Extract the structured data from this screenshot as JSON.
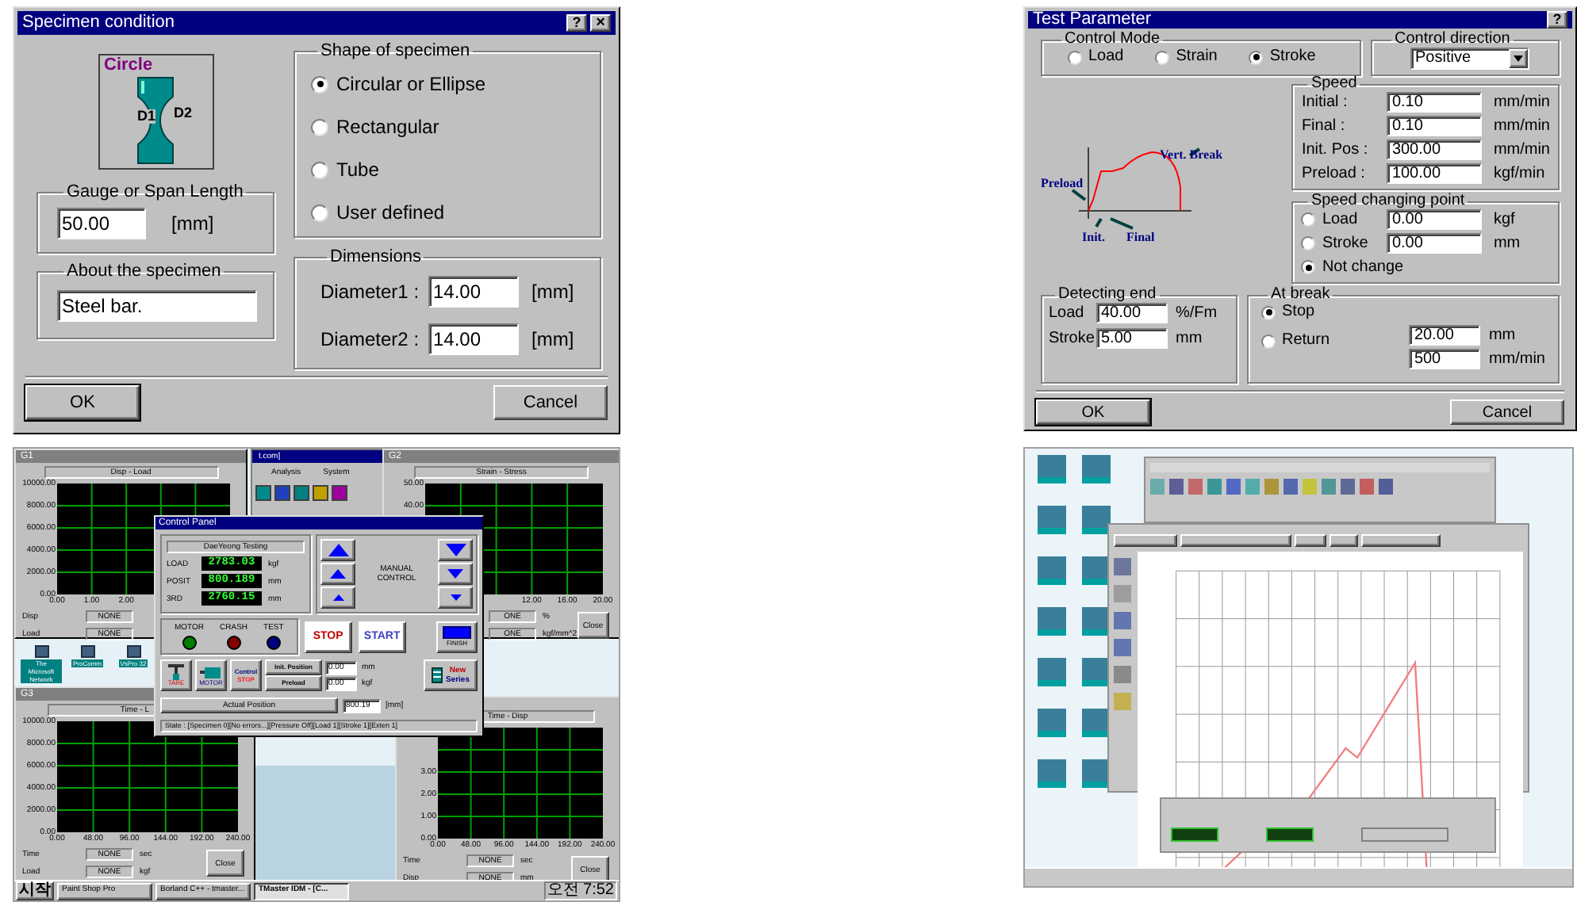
{
  "specimen_dialog": {
    "title": "Specimen condition",
    "help": "?",
    "close": "×",
    "picture": {
      "caption": "Circle",
      "d1": "D1",
      "d2": "D2"
    },
    "gauge": {
      "title": "Gauge or Span Length",
      "value": "50.00",
      "unit": "[mm]"
    },
    "about": {
      "title": "About the specimen",
      "value": "Steel bar."
    },
    "shape": {
      "title": "Shape of specimen",
      "options": [
        {
          "label": "Circular or Ellipse",
          "selected": true
        },
        {
          "label": "Rectangular",
          "selected": false
        },
        {
          "label": "Tube",
          "selected": false
        },
        {
          "label": "User defined",
          "selected": false
        }
      ]
    },
    "dimensions": {
      "title": "Dimensions",
      "rows": [
        {
          "label": "Diameter1 :",
          "value": "14.00",
          "unit": "[mm]"
        },
        {
          "label": "Diameter2 :",
          "value": "14.00",
          "unit": "[mm]"
        }
      ]
    },
    "buttons": [
      "OK",
      "Cancel"
    ]
  },
  "test_dialog": {
    "title": "Test Parameter",
    "help": "?",
    "control_mode": {
      "title": "Control Mode",
      "options": [
        {
          "label": "Load",
          "selected": false
        },
        {
          "label": "Strain",
          "selected": false
        },
        {
          "label": "Stroke",
          "selected": true
        }
      ]
    },
    "control_direction": {
      "title": "Control direction",
      "value": "Positive"
    },
    "diagram": {
      "vert_break": "Vert. Break",
      "preload": "Preload",
      "init": "Init.",
      "final": "Final"
    },
    "speed": {
      "title": "Speed",
      "rows": [
        {
          "label": "Initial :",
          "value": "0.10",
          "unit": "mm/min"
        },
        {
          "label": "Final :",
          "value": "0.10",
          "unit": "mm/min"
        },
        {
          "label": "Init. Pos :",
          "value": "300.00",
          "unit": "mm/min"
        },
        {
          "label": "Preload :",
          "value": "100.00",
          "unit": "kgf/min"
        }
      ]
    },
    "speed_changing_point": {
      "title": "Speed changing point",
      "options": [
        {
          "label": "Load",
          "value": "0.00",
          "unit": "kgf",
          "selected": false
        },
        {
          "label": "Stroke",
          "value": "0.00",
          "unit": "mm",
          "selected": false
        },
        {
          "label": "Not change",
          "selected": true
        }
      ]
    },
    "detecting_end": {
      "title": "Detecting end",
      "rows": [
        {
          "label": "Load",
          "value": "40.00",
          "unit": "%/Fm"
        },
        {
          "label": "Stroke",
          "value": "5.00",
          "unit": "mm"
        }
      ]
    },
    "at_break": {
      "title": "At break",
      "options": [
        {
          "label": "Stop",
          "selected": true
        },
        {
          "label": "Return",
          "selected": false
        }
      ],
      "fields": [
        {
          "value": "20.00",
          "unit": "mm"
        },
        {
          "value": "500",
          "unit": "mm/min"
        }
      ]
    },
    "buttons": [
      "OK",
      "Cancel"
    ]
  },
  "desktop": {
    "app_window": {
      "title": "t.com]",
      "menu": [
        "Analysis",
        "System"
      ]
    },
    "icons": [
      "The Microsoft Network",
      "ProComm",
      "VsPro 32"
    ],
    "graphs": [
      {
        "title": "G1",
        "caption": "Disp - Load",
        "y_ticks": [
          "10000.00",
          "8000.00",
          "6000.00",
          "4000.00",
          "2000.00",
          "0.00"
        ],
        "x_ticks": [
          "0.00",
          "1.00",
          "2.00"
        ],
        "readouts": [
          {
            "label": "Disp",
            "value": "NONE"
          },
          {
            "label": "Load",
            "value": "NONE"
          }
        ]
      },
      {
        "title": "G2",
        "caption": "Strain - Stress",
        "y_ticks": [
          "50.00",
          "40.00"
        ],
        "x_ticks": [
          "12.00",
          "16.00",
          "20.00"
        ],
        "readouts": [
          {
            "value": "ONE",
            "unit": "%"
          },
          {
            "value": "ONE",
            "unit": "kgf/mm^2"
          }
        ],
        "close": "Close"
      },
      {
        "title": "G3",
        "caption": "Time - L",
        "y_ticks": [
          "10000.00",
          "8000.00",
          "6000.00",
          "4000.00",
          "2000.00",
          "0.00"
        ],
        "x_ticks": [
          "0.00",
          "48.00",
          "96.00",
          "144.00",
          "192.00",
          "240.00"
        ],
        "readouts": [
          {
            "label": "Time",
            "value": "NONE",
            "unit": "sec"
          },
          {
            "label": "Load",
            "value": "NONE",
            "unit": "kgf"
          }
        ],
        "close": "Close"
      },
      {
        "caption": "Time - Disp",
        "y_ticks": [
          "3.00",
          "2.00",
          "1.00",
          "0.00"
        ],
        "x_ticks": [
          "0.00",
          "48.00",
          "96.00",
          "144.00",
          "192.00",
          "240.00"
        ],
        "readouts": [
          {
            "label": "Time",
            "value": "NONE",
            "unit": "sec"
          },
          {
            "label": "Disp",
            "value": "NONE",
            "unit": "mm"
          }
        ],
        "close": "Close"
      }
    ],
    "control_panel": {
      "title": "Control Panel",
      "caption": "DaeYeong Testing",
      "readouts": [
        {
          "label": "LOAD",
          "value": "2783.03",
          "unit": "kgf"
        },
        {
          "label": "POSIT",
          "value": "800.189",
          "unit": "mm"
        },
        {
          "label": "3RD",
          "value": "2760.15",
          "unit": "mm"
        }
      ],
      "manual_control": "MANUAL CONTROL",
      "lamps": [
        {
          "label": "MOTOR",
          "color": "#008000"
        },
        {
          "label": "CRASH",
          "color": "#800000"
        },
        {
          "label": "TEST",
          "color": "#000080"
        }
      ],
      "stop": "STOP",
      "start": "START",
      "finish": "FINISH",
      "tare": "TARE",
      "motor": "MOTOR",
      "control_stop": [
        "Control",
        "STOP"
      ],
      "init_position": "Init. Position",
      "preload": "Preload",
      "inputs": [
        {
          "value": "0.00",
          "unit": "mm"
        },
        {
          "value": "0.00",
          "unit": "kgf"
        }
      ],
      "new_series": [
        "New",
        "Series"
      ],
      "actual_position": "Actual Position",
      "actual_value": "800.19",
      "actual_unit": "[mm]",
      "status": "State : [Specimen 0][No errors...][Pressure Off][Load 1][Stroke 1][Exten 1]"
    },
    "taskbar": {
      "start": "시작",
      "tasks": [
        {
          "label": "Paint Shop Pro",
          "selected": false
        },
        {
          "label": "Borland C++ - tmaster...",
          "selected": false
        },
        {
          "label": "TMaster IDM - [C...",
          "selected": true
        }
      ],
      "clock": "오전 7:52"
    }
  }
}
